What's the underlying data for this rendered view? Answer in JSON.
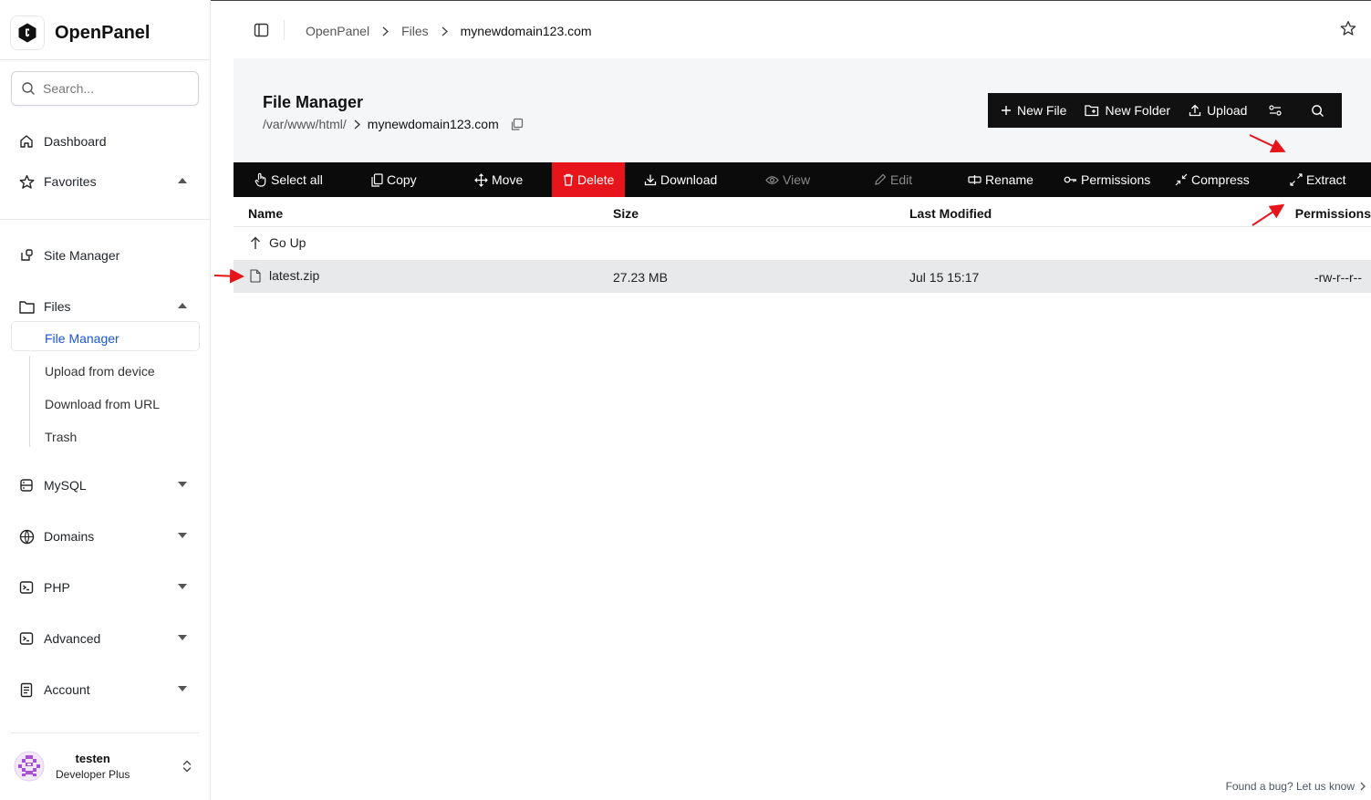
{
  "app": {
    "name": "OpenPanel"
  },
  "sidebar": {
    "search_placeholder": "Search...",
    "items": [
      {
        "label": "Dashboard"
      },
      {
        "label": "Favorites"
      },
      {
        "label": "Site Manager"
      },
      {
        "label": "Files"
      },
      {
        "label": "MySQL"
      },
      {
        "label": "Domains"
      },
      {
        "label": "PHP"
      },
      {
        "label": "Advanced"
      },
      {
        "label": "Account"
      }
    ],
    "files_sub": [
      {
        "label": "File Manager"
      },
      {
        "label": "Upload from device"
      },
      {
        "label": "Download from URL"
      },
      {
        "label": "Trash"
      }
    ],
    "user": {
      "name": "testen",
      "plan": "Developer Plus"
    }
  },
  "breadcrumb": [
    "OpenPanel",
    "Files",
    "mynewdomain123.com"
  ],
  "file_manager": {
    "title": "File Manager",
    "path_root": "/var/www/html/",
    "path_dir": "mynewdomain123.com"
  },
  "top_actions": {
    "new_file": "New File",
    "new_folder": "New Folder",
    "upload": "Upload"
  },
  "actions": {
    "select_all": "Select all",
    "copy": "Copy",
    "move": "Move",
    "delete": "Delete",
    "download": "Download",
    "view": "View",
    "edit": "Edit",
    "rename": "Rename",
    "permissions": "Permissions",
    "compress": "Compress",
    "extract": "Extract"
  },
  "table": {
    "headers": {
      "name": "Name",
      "size": "Size",
      "modified": "Last Modified",
      "permissions": "Permissions"
    },
    "go_up": "Go Up",
    "rows": [
      {
        "name": "latest.zip",
        "size": "27.23 MB",
        "modified": "Jul 15 15:17",
        "permissions": "-rw-r--r--"
      }
    ]
  },
  "footer": {
    "bug_link": "Found a bug? Let us know"
  },
  "colors": {
    "delete": "#e8141c",
    "active_link": "#1a56db",
    "toolbar": "#0b0b0b",
    "annotation": "#e8141c"
  }
}
